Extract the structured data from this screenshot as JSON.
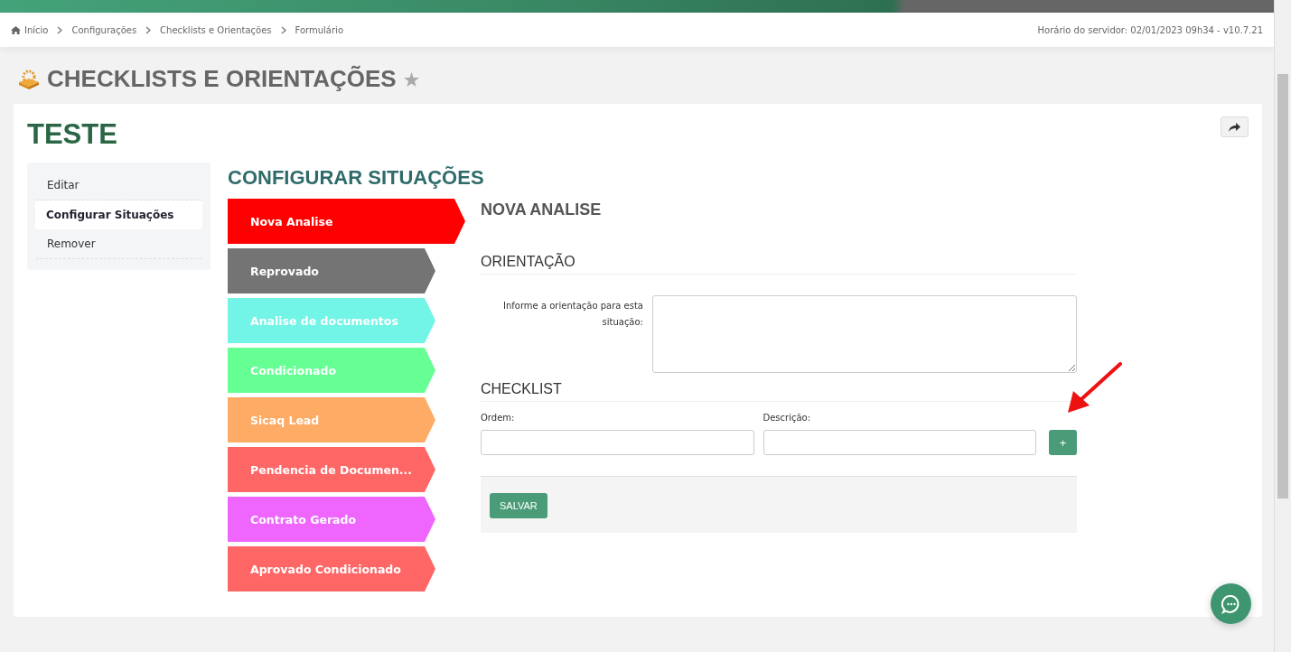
{
  "breadcrumb": [
    {
      "label": "Início",
      "kind": "home"
    },
    {
      "label": "Configurações",
      "kind": "link"
    },
    {
      "label": "Checklists e Orientações",
      "kind": "link"
    },
    {
      "label": "Formulário",
      "kind": "link"
    }
  ],
  "server_time": "Horário do servidor: 02/01/2023 09h34 - v10.7.21",
  "page_title": "CHECKLISTS E ORIENTAÇÕES",
  "record_title": "TESTE",
  "side_menu": [
    {
      "label": "Editar",
      "selected": false
    },
    {
      "label": "Configurar Situações",
      "selected": true
    },
    {
      "label": "Remover",
      "selected": false
    }
  ],
  "section_title": "CONFIGURAR SITUAÇÕES",
  "situations": [
    {
      "label": "Nova Analise",
      "color": "#ff0000",
      "selected": true
    },
    {
      "label": "Reprovado",
      "color": "#747474",
      "selected": false
    },
    {
      "label": "Analise de documentos",
      "color": "#72f4e6",
      "selected": false
    },
    {
      "label": "Condicionado",
      "color": "#66ff94",
      "selected": false
    },
    {
      "label": "Sicaq Lead",
      "color": "#feab66",
      "selected": false
    },
    {
      "label": "Pendencia de Documen...",
      "color": "#ff6666",
      "selected": false
    },
    {
      "label": "Contrato Gerado",
      "color": "#ee66fe",
      "selected": false
    },
    {
      "label": "Aprovado Condicionado",
      "color": "#ff6666",
      "selected": false
    }
  ],
  "detail": {
    "title": "NOVA ANALISE",
    "orientation_heading": "ORIENTAÇÃO",
    "orientation_label": "Informe a orientação para esta situação:",
    "checklist_heading": "CHECKLIST",
    "order_label": "Ordem:",
    "description_label": "Descrição:",
    "add_button": "+",
    "save_button": "SALVAR"
  }
}
